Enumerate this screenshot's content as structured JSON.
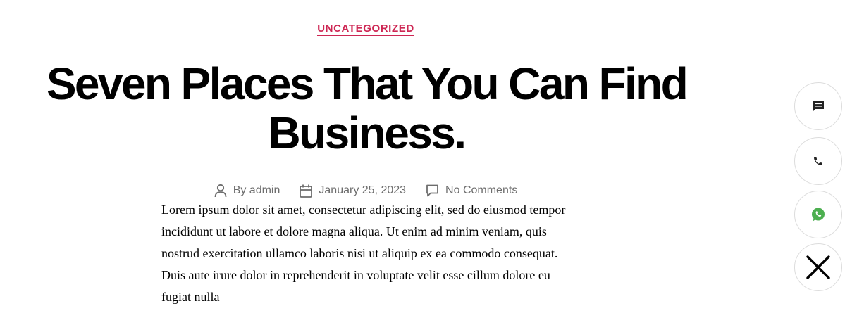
{
  "post": {
    "category": "UNCATEGORIZED",
    "title": "Seven Places That You Can Find Business.",
    "meta": {
      "author": "By admin",
      "date": "January 25, 2023",
      "comments": "No Comments"
    },
    "excerpt": "Lorem ipsum dolor sit amet, consectetur adipiscing elit, sed do eiusmod tempor incididunt ut labore et dolore magna aliqua. Ut enim ad minim veniam, quis nostrud exercitation ullamco laboris nisi ut aliquip ex ea commodo consequat. Duis aute irure dolor in reprehenderit in voluptate velit esse cillum dolore eu fugiat nulla"
  },
  "colors": {
    "accent": "#cd2653",
    "meta_text": "#6d6d6d",
    "whatsapp": "#4caf50"
  },
  "floating_buttons": [
    {
      "icon": "chat-bubble-icon"
    },
    {
      "icon": "phone-icon"
    },
    {
      "icon": "whatsapp-icon"
    },
    {
      "icon": "close-icon"
    }
  ]
}
